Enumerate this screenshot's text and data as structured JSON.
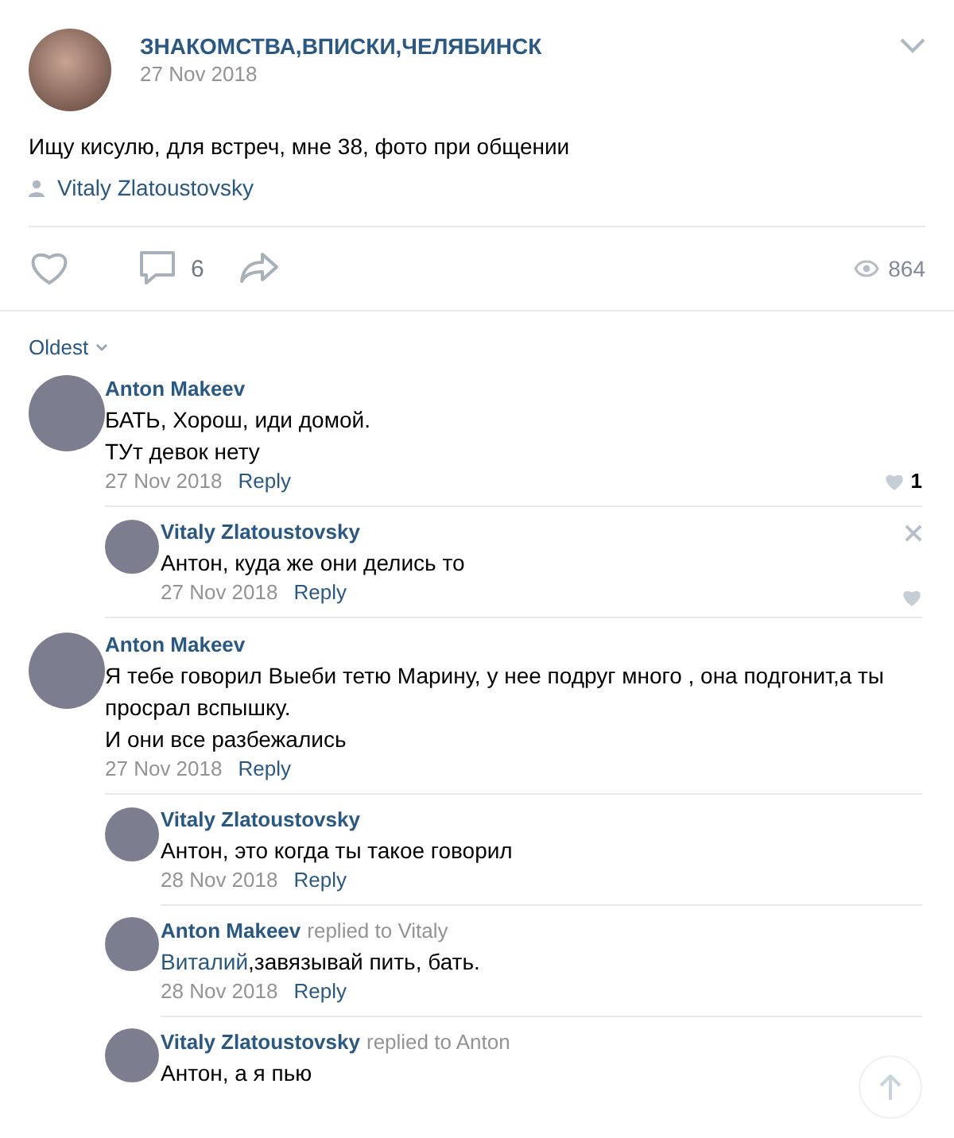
{
  "post": {
    "author": "ЗНАКОМСТВА,ВПИСКИ,ЧЕЛЯБИНСК",
    "date": "27 Nov 2018",
    "text": "Ищу кисулю, для встреч, мне 38, фото при общении",
    "signer": "Vitaly Zlatoustovsky"
  },
  "actions": {
    "comments": "6",
    "views": "864"
  },
  "sort": {
    "label": "Oldest"
  },
  "comments": [
    {
      "author": "Anton Makeev",
      "text": "БАТЬ, Хорош, иди домой.\nТУт девок нету",
      "date": "27 Nov 2018",
      "reply": "Reply",
      "likes": "1",
      "replies": [
        {
          "author": "Vitaly Zlatoustovsky",
          "text": "Антон, куда же они делись то",
          "date": "27 Nov 2018",
          "reply": "Reply",
          "hovered": true
        }
      ]
    },
    {
      "author": "Anton Makeev",
      "text": "Я тебе говорил Выеби тетю Марину, у нее подруг много , она подгонит,а ты просрал вспышку.\nИ они все разбежались",
      "date": "27 Nov 2018",
      "reply": "Reply",
      "replies": [
        {
          "author": "Vitaly Zlatoustovsky",
          "text": "Антон, это когда ты такое говорил",
          "date": "28 Nov 2018",
          "reply": "Reply",
          "hovered": false
        },
        {
          "author": "Anton Makeev",
          "replied_to": "replied to Vitaly",
          "mention": "Виталий",
          "text": ",завязывай пить, бать.",
          "date": "28 Nov 2018",
          "reply": "Reply",
          "hovered": false
        },
        {
          "author": "Vitaly Zlatoustovsky",
          "replied_to": "replied to Anton",
          "text": "Антон, а я пью",
          "hovered": false
        }
      ]
    }
  ]
}
